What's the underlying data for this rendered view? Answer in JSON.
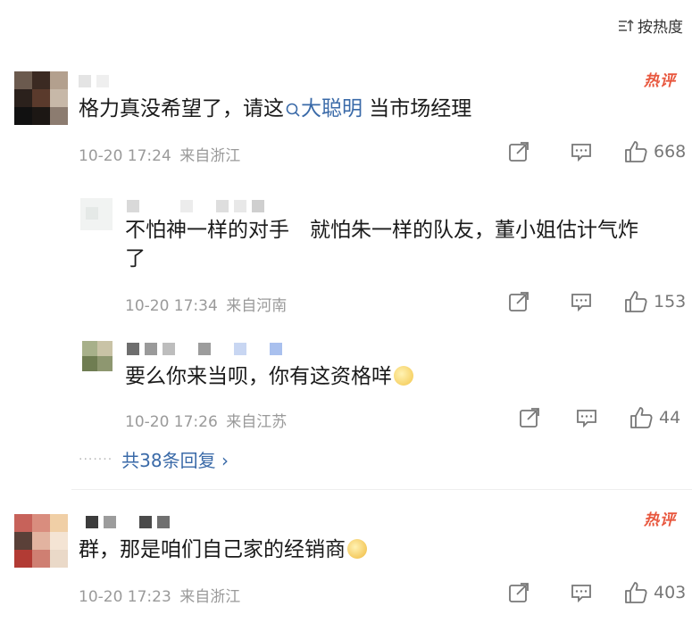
{
  "sort": {
    "label": "按热度"
  },
  "comments": [
    {
      "hot_badge": "热评",
      "text_before": "格力真没希望了，请这",
      "mention": "大聪明",
      "text_after": " 当市场经理",
      "date": "10-20 17:24",
      "location": "来自浙江",
      "likes": "668"
    },
    {
      "hot_badge": "热评",
      "text": "群，那是咱们自己家的经销商",
      "date": "10-20 17:23",
      "location": "来自浙江",
      "likes": "403"
    }
  ],
  "replies": [
    {
      "text": "不怕神一样的对手　就怕朱一样的队友，董小姐估计气炸了",
      "date": "10-20 17:34",
      "location": "来自河南",
      "likes": "153"
    },
    {
      "text": "要么你来当呗，你有这资格咩",
      "date": "10-20 17:26",
      "location": "来自江苏",
      "likes": "44"
    }
  ],
  "reply_more": {
    "dots": "·······",
    "label": "共38条回复 ›"
  },
  "colors": {
    "link": "#3a6aa8",
    "hot": "#e8573e",
    "meta": "#9a9a9a"
  },
  "icons": [
    "sort-icon",
    "share-icon",
    "comment-icon",
    "like-icon",
    "search-mention-icon",
    "emoji-icon"
  ]
}
